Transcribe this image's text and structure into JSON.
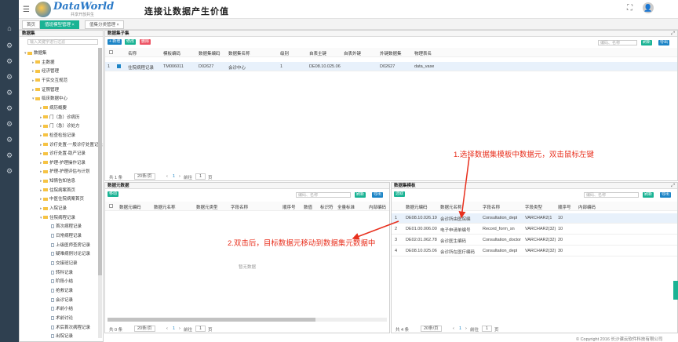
{
  "app": {
    "logo_text": "DataWorld",
    "logo_sub": "共享开放共生",
    "slogan": "连接让数据产生价值",
    "menu_icon": "hamburger-icon",
    "avatar_icon": "user-avatar-icon"
  },
  "tabs": [
    {
      "label": "首页"
    },
    {
      "label": "值班模型管理 ×"
    },
    {
      "label": "值集分类管理 ×"
    }
  ],
  "tree": {
    "title": "数据集",
    "search_placeholder": "输入关键字进行过滤",
    "nodes": [
      {
        "label": "数据集",
        "depth": 0,
        "type": "folder"
      },
      {
        "label": "主数据",
        "depth": 1,
        "type": "folder"
      },
      {
        "label": "经济管理",
        "depth": 1,
        "type": "folder"
      },
      {
        "label": "干实交互规范",
        "depth": 1,
        "type": "folder"
      },
      {
        "label": "证照管理",
        "depth": 1,
        "type": "folder"
      },
      {
        "label": "临床数据中心",
        "depth": 1,
        "type": "folder"
      },
      {
        "label": "病历概要",
        "depth": 2,
        "type": "folder"
      },
      {
        "label": "门（急）诊病历",
        "depth": 2,
        "type": "folder"
      },
      {
        "label": "门（急）诊处方",
        "depth": 2,
        "type": "folder"
      },
      {
        "label": "检查检验记录",
        "depth": 2,
        "type": "folder"
      },
      {
        "label": "诊疗处置-一般诊疗处置记录",
        "depth": 2,
        "type": "folder"
      },
      {
        "label": "诊疗处置-助产记录",
        "depth": 2,
        "type": "folder"
      },
      {
        "label": "护理-护理操作记录",
        "depth": 2,
        "type": "folder"
      },
      {
        "label": "护理-护理评估与计划",
        "depth": 2,
        "type": "folder"
      },
      {
        "label": "知情告知信息",
        "depth": 2,
        "type": "folder"
      },
      {
        "label": "住院病案首页",
        "depth": 2,
        "type": "folder"
      },
      {
        "label": "中医住院病案首页",
        "depth": 2,
        "type": "folder"
      },
      {
        "label": "入院记录",
        "depth": 2,
        "type": "folder"
      },
      {
        "label": "住院病程记录",
        "depth": 2,
        "type": "folder"
      },
      {
        "label": "首次病程记录",
        "depth": 3,
        "type": "doc"
      },
      {
        "label": "日常病程记录",
        "depth": 3,
        "type": "doc"
      },
      {
        "label": "上级医师查房记录",
        "depth": 3,
        "type": "doc"
      },
      {
        "label": "疑难病例讨论记录",
        "depth": 3,
        "type": "doc"
      },
      {
        "label": "交接班记录",
        "depth": 3,
        "type": "doc"
      },
      {
        "label": "转科记录",
        "depth": 3,
        "type": "doc"
      },
      {
        "label": "阶段小结",
        "depth": 3,
        "type": "doc"
      },
      {
        "label": "抢救记录",
        "depth": 3,
        "type": "doc"
      },
      {
        "label": "会诊记录",
        "depth": 3,
        "type": "doc"
      },
      {
        "label": "术前小结",
        "depth": 3,
        "type": "doc"
      },
      {
        "label": "术前讨论",
        "depth": 3,
        "type": "doc"
      },
      {
        "label": "术后首次病程记录",
        "depth": 3,
        "type": "doc"
      },
      {
        "label": "出院记录",
        "depth": 3,
        "type": "doc"
      }
    ]
  },
  "subset": {
    "title": "数据集子集",
    "btn_add": "+ 新增",
    "btn_edit": "修改",
    "btn_delete": "删除",
    "search_placeholder": "编码、名称",
    "btn_refresh": "刷新",
    "btn_export": "导出",
    "columns": [
      "名称",
      "模板编码",
      "数据集编码",
      "数据集名称",
      "级别",
      "自表主键",
      "自表外键",
      "外键数据集",
      "物理表名"
    ],
    "rows": [
      {
        "idx": "1",
        "name": "住院病程记录",
        "tpl": "TM006011",
        "ds": "D02627",
        "dsname": "会诊中心",
        "level": "1",
        "pk": "DE08.10.025.06",
        "fk": "",
        "fkds": "D02627",
        "table": "data_vase"
      }
    ],
    "pager": {
      "total": "共 1 条",
      "size": "20条/页",
      "goto": "前往",
      "page": "1",
      "unit": "页"
    }
  },
  "elements": {
    "title": "数据元数据",
    "btn_move": "移动",
    "search_placeholder": "编码、名称",
    "btn_refresh": "刷新",
    "btn_export": "导出",
    "columns": [
      "数据元编码",
      "数据元名称",
      "数据元类型",
      "字段名称",
      "顺序号",
      "数值",
      "标识符",
      "全量标准",
      "内部编码"
    ],
    "empty": "暂无数据",
    "pager": {
      "total": "共 0 条",
      "size": "20条/页",
      "goto": "前往",
      "page": "1",
      "unit": "页"
    }
  },
  "template": {
    "title": "数据集模板",
    "btn_sel": "选取",
    "search_placeholder": "编码、名称",
    "btn_refresh": "刷新",
    "btn_export": "导出",
    "columns": [
      "数据元编码",
      "数据元名称",
      "字段名称",
      "字段类型",
      "顺序号",
      "内部编码"
    ],
    "rows": [
      {
        "i": "1",
        "code": "DE08.10.026.19",
        "name": "会诊所由医院编",
        "field": "Consultation_dept",
        "type": "VARCHAR2(1",
        "seq": "10"
      },
      {
        "i": "2",
        "code": "DE01.00.006.00",
        "name": "电子申请单编号",
        "field": "Record_form_sn",
        "type": "VARCHAR2(32)",
        "seq": "10"
      },
      {
        "i": "3",
        "code": "DE02.01.062.78",
        "name": "会诊医生编码",
        "field": "Consultation_doctor",
        "type": "VARCHAR2(32)",
        "seq": "20"
      },
      {
        "i": "4",
        "code": "DE08.10.025.06",
        "name": "会诊所在医疗编码",
        "field": "Consultation_dept",
        "type": "VARCHAR2(32)",
        "seq": "30"
      }
    ],
    "pager": {
      "total": "共 4 条",
      "size": "20条/页",
      "goto": "前往",
      "page": "1",
      "unit": "页"
    }
  },
  "annotations": {
    "step1": "1.选择数据集模板中数据元，双击鼠标左键",
    "step2": "2.双击后，目标数据元移动到数据集元数据中"
  },
  "footer": {
    "copyright": "© Copyright 2016 长沙课云软件科技有限公司"
  },
  "colors": {
    "sidebar": "#2f4050",
    "green": "#1ab394",
    "blue": "#1c84c6",
    "red": "#ed5565",
    "annotation": "#e8301e"
  }
}
